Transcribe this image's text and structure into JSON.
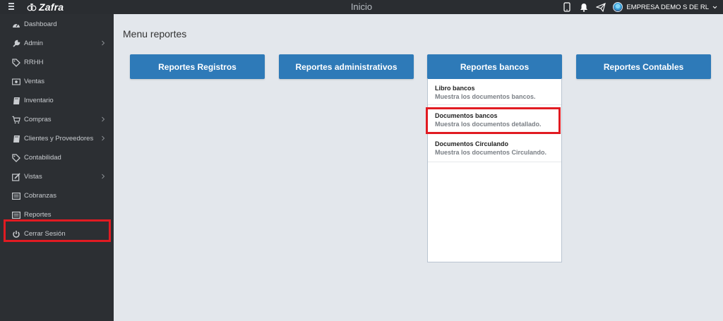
{
  "topbar": {
    "logo_text": "Zafra",
    "title": "Inicio",
    "company": "EMPRESA DEMO S DE RL"
  },
  "sidebar": {
    "items": [
      {
        "label": "Dashboard",
        "icon": "dashboard-icon"
      },
      {
        "label": "Admin",
        "icon": "wrench-icon"
      },
      {
        "label": "RRHH",
        "icon": "tag-icon"
      },
      {
        "label": "Ventas",
        "icon": "money-icon"
      },
      {
        "label": "Inventario",
        "icon": "book-icon"
      },
      {
        "label": "Compras",
        "icon": "cart-icon"
      },
      {
        "label": "Clientes y Proveedores",
        "icon": "book-icon"
      },
      {
        "label": "Contabilidad",
        "icon": "tag-icon"
      },
      {
        "label": "Vistas",
        "icon": "edit-icon"
      },
      {
        "label": "Cobranzas",
        "icon": "list-icon"
      },
      {
        "label": "Reportes",
        "icon": "list-icon"
      },
      {
        "label": "Cerrar Sesión",
        "icon": "power-icon"
      }
    ]
  },
  "main": {
    "page_title": "Menu reportes",
    "buttons": [
      {
        "label": "Reportes Registros"
      },
      {
        "label": "Reportes administrativos"
      },
      {
        "label": "Reportes bancos"
      },
      {
        "label": "Reportes Contables"
      }
    ],
    "dropdown": {
      "items": [
        {
          "title": "Libro bancos",
          "desc": "Muestra los documentos bancos."
        },
        {
          "title": "Documentos bancos",
          "desc": "Muestra los documentos detallado."
        },
        {
          "title": "Documentos Circulando",
          "desc": "Muestra los documentos Circulando."
        }
      ]
    }
  },
  "colors": {
    "accent": "#2e7ab8",
    "sidebar_bg": "#2c2f33",
    "topbar_bg": "#2a2d31",
    "highlight": "#e11b22",
    "page_bg": "#e3e7ec"
  }
}
